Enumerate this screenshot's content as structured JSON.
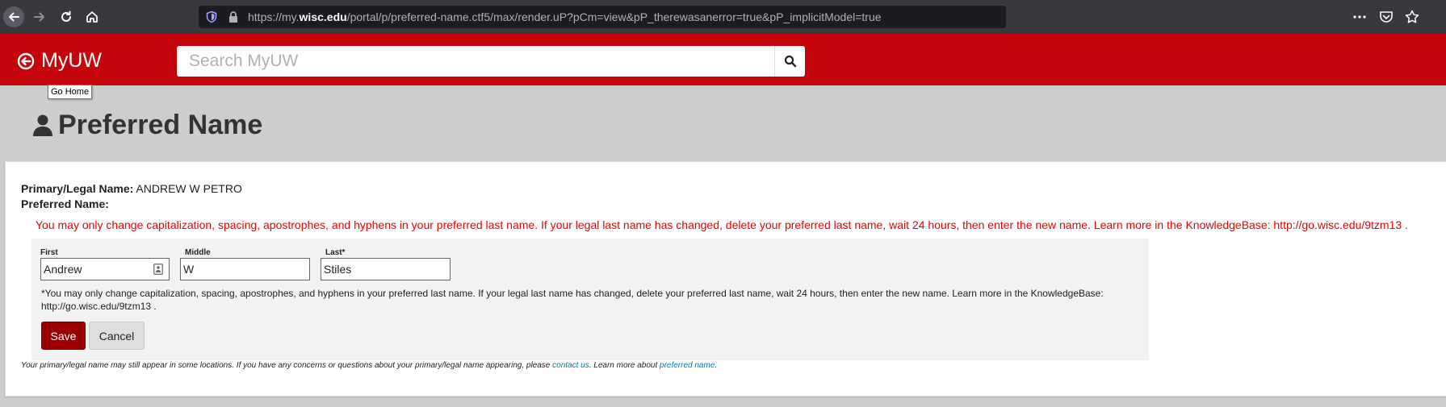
{
  "browser": {
    "url_prefix": "https://my.",
    "url_host": "wisc.edu",
    "url_path": "/portal/p/preferred-name.ctf5/max/render.uP?pCm=view&pP_therewasanerror=true&pP_implicitModel=true",
    "icons": [
      "back-arrow-icon",
      "forward-arrow-icon",
      "reload-icon",
      "home-icon",
      "shield-icon",
      "lock-icon",
      "more-icon",
      "pocket-icon",
      "bookmark-star-icon"
    ]
  },
  "header": {
    "logo_text": "MyUW",
    "search_placeholder": "Search MyUW",
    "tooltip": "Go Home",
    "brand_color": "#c5050c"
  },
  "page": {
    "title": "Preferred Name"
  },
  "content": {
    "legal_label": "Primary/Legal Name:",
    "legal_value": "ANDREW W PETRO",
    "preferred_label": "Preferred Name:",
    "error_message": "You may only change capitalization, spacing, apostrophes, and hyphens in your preferred last name. If your legal last name has changed, delete your preferred last name, wait 24 hours, then enter the new name. Learn more in the KnowledgeBase: http://go.wisc.edu/9tzm13 .",
    "form": {
      "first_label": "First",
      "first_value": "Andrew",
      "middle_label": "Middle",
      "middle_value": "W",
      "last_label": "Last*",
      "last_value": "Stiles",
      "note": "*You may only change capitalization, spacing, apostrophes, and hyphens in your preferred last name. If your legal last name has changed, delete your preferred last name, wait 24 hours, then enter the new name. Learn more in the KnowledgeBase: http://go.wisc.edu/9tzm13 .",
      "save_label": "Save",
      "cancel_label": "Cancel"
    },
    "footnote_text": "Your primary/legal name may still appear in some locations. If you have any concerns or questions about your primary/legal name appearing, please ",
    "footnote_link1": "contact us",
    "footnote_mid": ". Learn more about ",
    "footnote_link2": "preferred name",
    "footnote_end": "."
  }
}
